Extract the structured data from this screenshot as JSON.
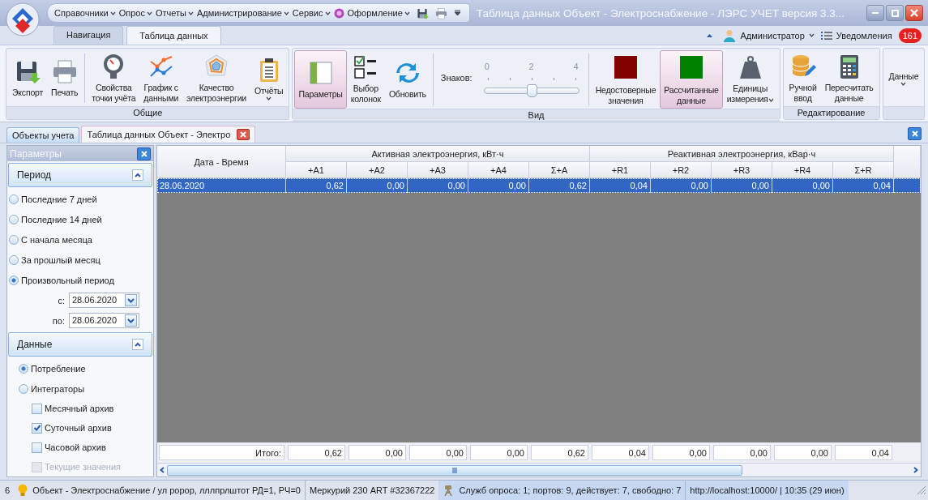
{
  "window": {
    "title": "Таблица данных Объект - Электроснабжение - ЛЭРС УЧЕТ версия 3.3...",
    "menu": [
      {
        "kind": "plain",
        "label": "Справочники"
      },
      {
        "kind": "plain",
        "label": "Опрос"
      },
      {
        "kind": "plain",
        "label": "Отчеты"
      },
      {
        "kind": "plain",
        "label": "Администрирование"
      },
      {
        "kind": "plain",
        "label": "Сервис"
      },
      {
        "kind": "themed",
        "label": "Оформление"
      }
    ]
  },
  "ribbon_tabs": [
    {
      "label": "Навигация",
      "selected": false
    },
    {
      "label": "Таблица данных",
      "selected": true
    }
  ],
  "account": {
    "user": "Администратор",
    "notifications": "Уведомления",
    "badge": "161"
  },
  "ribbon_groups": [
    {
      "title": "Общие",
      "items": [
        {
          "kind": "button",
          "lines": [
            "Экспорт"
          ],
          "selected": false
        },
        {
          "kind": "button",
          "lines": [
            "Печать"
          ],
          "selected": false
        },
        {
          "kind": "separator"
        },
        {
          "kind": "button",
          "lines": [
            "Свойства",
            "точки учёта"
          ],
          "selected": false
        },
        {
          "kind": "button",
          "lines": [
            "График с",
            "данными"
          ],
          "selected": false
        },
        {
          "kind": "button",
          "lines": [
            "Качество",
            "электроэнергии"
          ],
          "selected": false
        },
        {
          "kind": "button",
          "lines": [
            "Отчёты"
          ],
          "selected": false,
          "dropdown": true
        }
      ]
    },
    {
      "title": "Вид",
      "items": [
        {
          "kind": "button",
          "lines": [
            "Параметры"
          ],
          "selected": true
        },
        {
          "kind": "button",
          "lines": [
            "Выбор",
            "колонок"
          ],
          "selected": false
        },
        {
          "kind": "button",
          "lines": [
            "Обновить"
          ],
          "selected": false
        },
        {
          "kind": "separator"
        },
        {
          "kind": "slider",
          "label": "Знаков:",
          "ticks": [
            "0",
            "2",
            "4"
          ],
          "level": 0.5
        },
        {
          "kind": "separator"
        },
        {
          "kind": "swatch",
          "color": "#800000",
          "lines": [
            "Недостоверные",
            "значения"
          ],
          "selected": false
        },
        {
          "kind": "swatch",
          "color": "#008000",
          "lines": [
            "Рассчитанные",
            "данные"
          ],
          "selected": true
        },
        {
          "kind": "button",
          "lines": [
            "Единицы",
            "измерения"
          ],
          "selected": false,
          "dropdown": true
        }
      ]
    },
    {
      "title": "Редактирование",
      "items": [
        {
          "kind": "button",
          "lines": [
            "Ручной",
            "ввод"
          ],
          "selected": false
        },
        {
          "kind": "button",
          "lines": [
            "Пересчитать",
            "данные"
          ],
          "selected": false
        }
      ]
    },
    {
      "items": [
        {
          "kind": "button",
          "lines": [
            "Данные"
          ],
          "selected": false,
          "dropdown": true
        }
      ]
    }
  ],
  "doc_tabs": [
    {
      "label": "Объекты учета",
      "selected": false,
      "closable": false
    },
    {
      "label": "Таблица данных Объект - Электро",
      "selected": true,
      "closable": true
    }
  ],
  "sidebar": {
    "title": "Параметры",
    "sections": [
      {
        "title": "Период",
        "expanded": true,
        "items": [
          {
            "kind": "radio",
            "label": "Последние 7 дней",
            "selected": false
          },
          {
            "kind": "radio",
            "label": "Последние 14 дней",
            "selected": false
          },
          {
            "kind": "radio",
            "label": "С начала месяца",
            "selected": false
          },
          {
            "kind": "radio",
            "label": "За прошлый месяц",
            "selected": false
          },
          {
            "kind": "radio",
            "label": "Произвольный период",
            "selected": true
          },
          {
            "kind": "date",
            "label": "с:",
            "value": "28.06.2020"
          },
          {
            "kind": "date",
            "label": "по:",
            "value": "28.06.2020"
          }
        ]
      },
      {
        "title": "Данные",
        "expanded": true,
        "items": [
          {
            "kind": "radio",
            "label": "Потребление",
            "selected": true
          },
          {
            "kind": "radio",
            "label": "Интеграторы",
            "selected": false,
            "children": [
              {
                "kind": "checkbox",
                "label": "Месячный архив",
                "checked": false,
                "disabled": false
              },
              {
                "kind": "checkbox",
                "label": "Суточный архив",
                "checked": true,
                "disabled": false
              },
              {
                "kind": "checkbox",
                "label": "Часовой архив",
                "checked": false,
                "disabled": false
              },
              {
                "kind": "checkbox",
                "label": "Текущие значения",
                "checked": false,
                "disabled": true
              }
            ]
          }
        ]
      }
    ]
  },
  "table": {
    "date_header": "Дата - Время",
    "groups": [
      {
        "label": "Активная электроэнергия, кВт·ч",
        "columns": [
          "+A1",
          "+A2",
          "+A3",
          "+A4",
          "Σ+A"
        ]
      },
      {
        "label": "Реактивная электроэнергия, кВар·ч",
        "columns": [
          "+R1",
          "+R2",
          "+R3",
          "+R4",
          "Σ+R"
        ]
      }
    ],
    "rows": [
      {
        "date": "28.06.2020",
        "values": [
          "0,62",
          "0,00",
          "0,00",
          "0,00",
          "0,62",
          "0,04",
          "0,00",
          "0,00",
          "0,00",
          "0,04"
        ],
        "selected": true
      }
    ],
    "totals": {
      "label": "Итого:",
      "values": [
        "0,62",
        "0,00",
        "0,00",
        "0,00",
        "0,62",
        "0,04",
        "0,00",
        "0,00",
        "0,00",
        "0,04"
      ]
    }
  },
  "status_bar": [
    {
      "kind": "count",
      "text": "6"
    },
    {
      "kind": "object",
      "text": "Объект - Электроснабжение / ул ророр, лллпрлштот  РД=1, РЧ=0"
    },
    {
      "kind": "device",
      "text": "Меркурий 230 ART #32367222"
    },
    {
      "kind": "service",
      "text": "Служб опроса: 1; портов: 9, действует: 7, свободно: 7"
    },
    {
      "kind": "server",
      "text": "http://localhost:10000/ | 10:35 (29 июн)"
    }
  ]
}
